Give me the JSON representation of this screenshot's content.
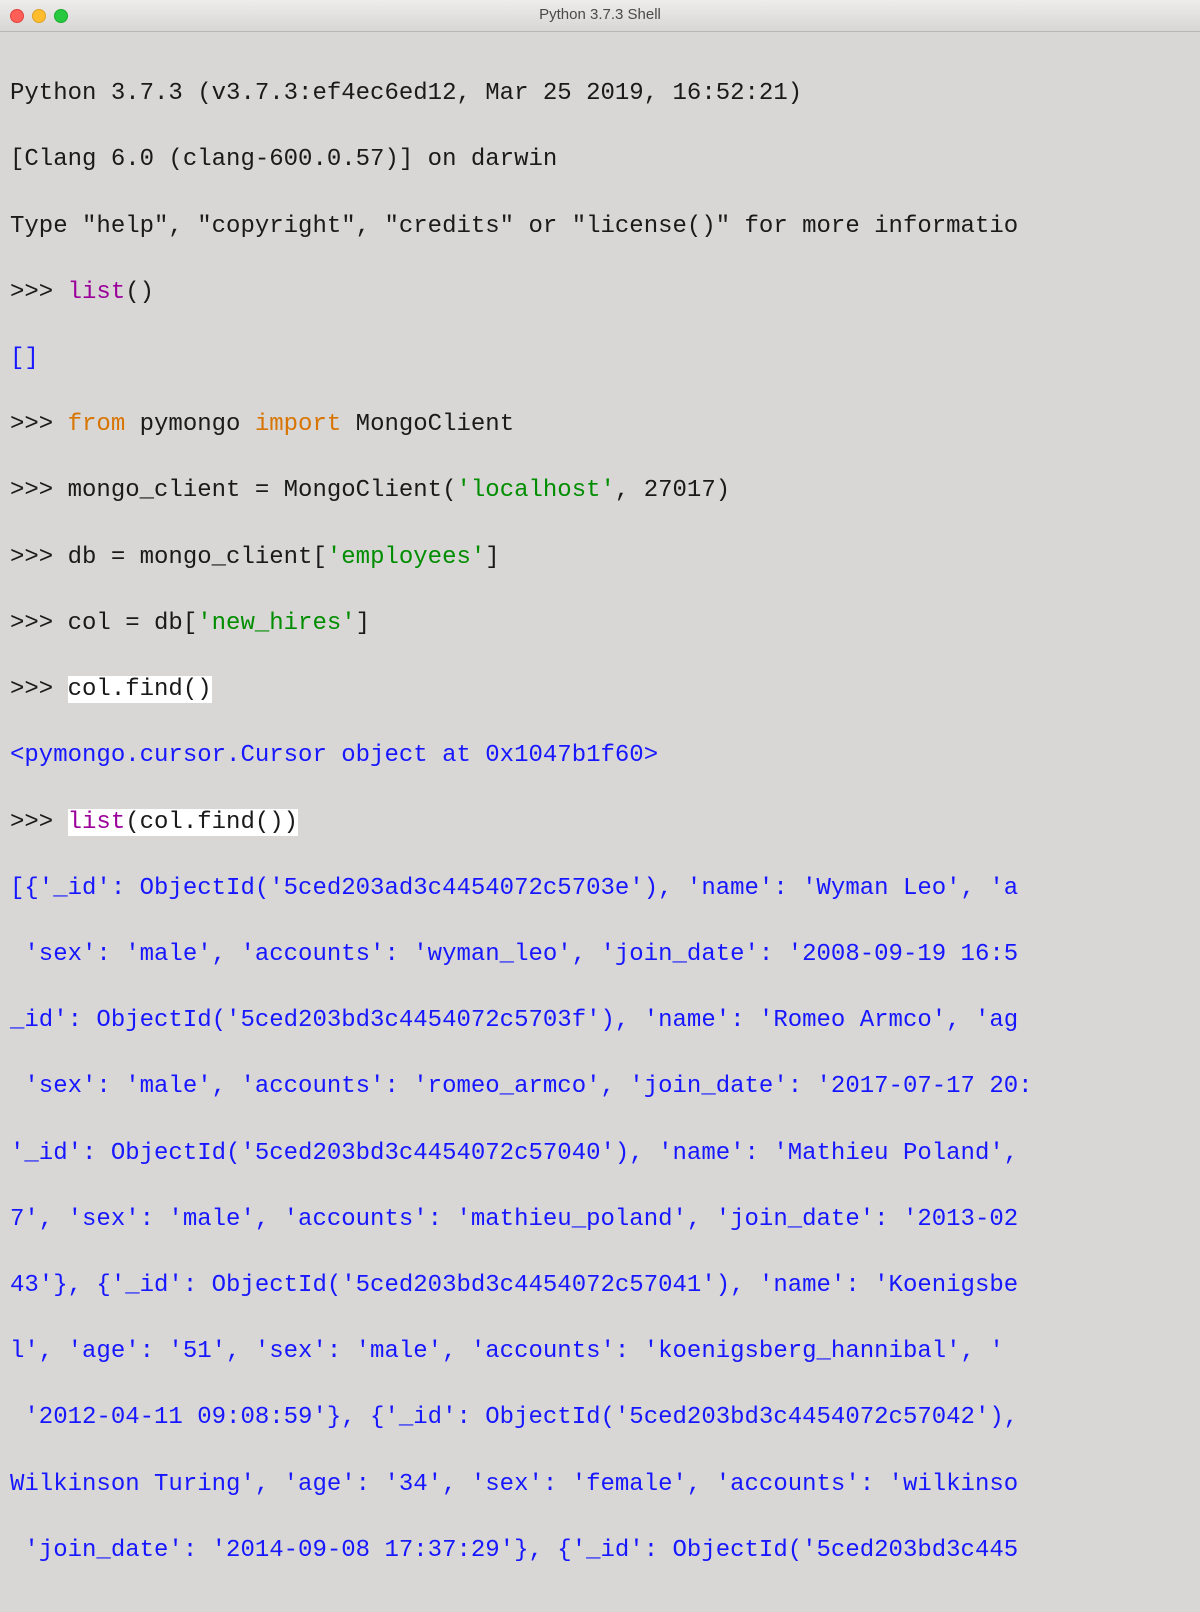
{
  "window": {
    "title": "Python 3.7.3 Shell"
  },
  "lines": {
    "l1": "Python 3.7.3 (v3.7.3:ef4ec6ed12, Mar 25 2019, 16:52:21)",
    "l2": "[Clang 6.0 (clang-600.0.57)] on darwin",
    "l3": "Type \"help\", \"copyright\", \"credits\" or \"license()\" for more informatio",
    "prompt": ">>> ",
    "list_call": "list",
    "list_parens": "()",
    "empty_list": "[]",
    "kw_from": "from",
    "mod_pymongo": " pymongo ",
    "kw_import": "import",
    "cls_mongoclient": " MongoClient",
    "l6a": "mongo_client = MongoClient(",
    "str_localhost": "'localhost'",
    "l6b": ", 27017)",
    "l7a": "db = mongo_client[",
    "str_employees": "'employees'",
    "l7b": "]",
    "l8a": "col = db[",
    "str_newhires": "'new_hires'",
    "l8b": "]",
    "col_find": "col.find()",
    "cursor_repr": "<pymongo.cursor.Cursor object at 0x1047b1f60>",
    "list_open": "list",
    "list_arg": "(col.find())",
    "r1": "[{'_id': ObjectId('5ced203ad3c4454072c5703e'), 'name': 'Wyman Leo', 'a",
    "r2": " 'sex': 'male', 'accounts': 'wyman_leo', 'join_date': '2008-09-19 16:5",
    "r3": "_id': ObjectId('5ced203bd3c4454072c5703f'), 'name': 'Romeo Armco', 'ag",
    "r4": " 'sex': 'male', 'accounts': 'romeo_armco', 'join_date': '2017-07-17 20:",
    "r5": "'_id': ObjectId('5ced203bd3c4454072c57040'), 'name': 'Mathieu Poland',",
    "r6": "7', 'sex': 'male', 'accounts': 'mathieu_poland', 'join_date': '2013-02",
    "r7": "43'}, {'_id': ObjectId('5ced203bd3c4454072c57041'), 'name': 'Koenigsbe",
    "r8": "l', 'age': '51', 'sex': 'male', 'accounts': 'koenigsberg_hannibal', '",
    "r9": " '2012-04-11 09:08:59'}, {'_id': ObjectId('5ced203bd3c4454072c57042'),",
    "r10": "Wilkinson Turing', 'age': '34', 'sex': 'female', 'accounts': 'wilkinso",
    "r11": " 'join_date': '2014-09-08 17:37:29'}, {'_id': ObjectId('5ced203bd3c445"
  }
}
